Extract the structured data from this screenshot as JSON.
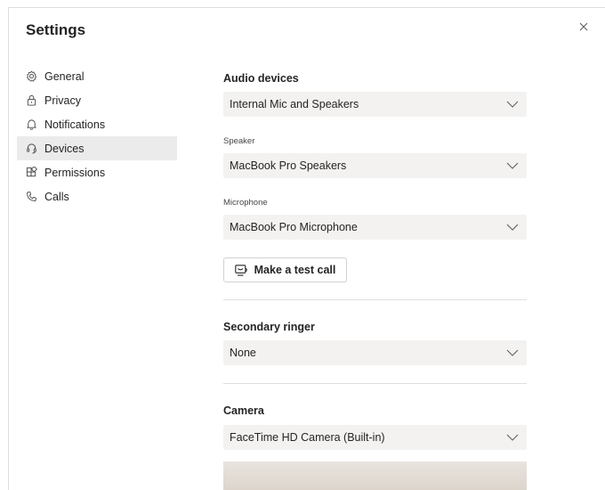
{
  "header": {
    "title": "Settings"
  },
  "nav": {
    "items": [
      {
        "label": "General",
        "icon": "gear-icon"
      },
      {
        "label": "Privacy",
        "icon": "lock-icon"
      },
      {
        "label": "Notifications",
        "icon": "bell-icon"
      },
      {
        "label": "Devices",
        "icon": "headset-icon",
        "active": true
      },
      {
        "label": "Permissions",
        "icon": "apps-icon"
      },
      {
        "label": "Calls",
        "icon": "phone-icon"
      }
    ]
  },
  "audio": {
    "title": "Audio devices",
    "device_value": "Internal Mic and Speakers",
    "speaker_label": "Speaker",
    "speaker_value": "MacBook Pro Speakers",
    "microphone_label": "Microphone",
    "microphone_value": "MacBook Pro Microphone",
    "test_call_label": "Make a test call"
  },
  "ringer": {
    "title": "Secondary ringer",
    "value": "None"
  },
  "camera": {
    "title": "Camera",
    "value": "FaceTime HD Camera (Built-in)"
  },
  "colors": {
    "active_nav_bg": "#ebebeb",
    "dropdown_bg": "#f3f2f1"
  }
}
